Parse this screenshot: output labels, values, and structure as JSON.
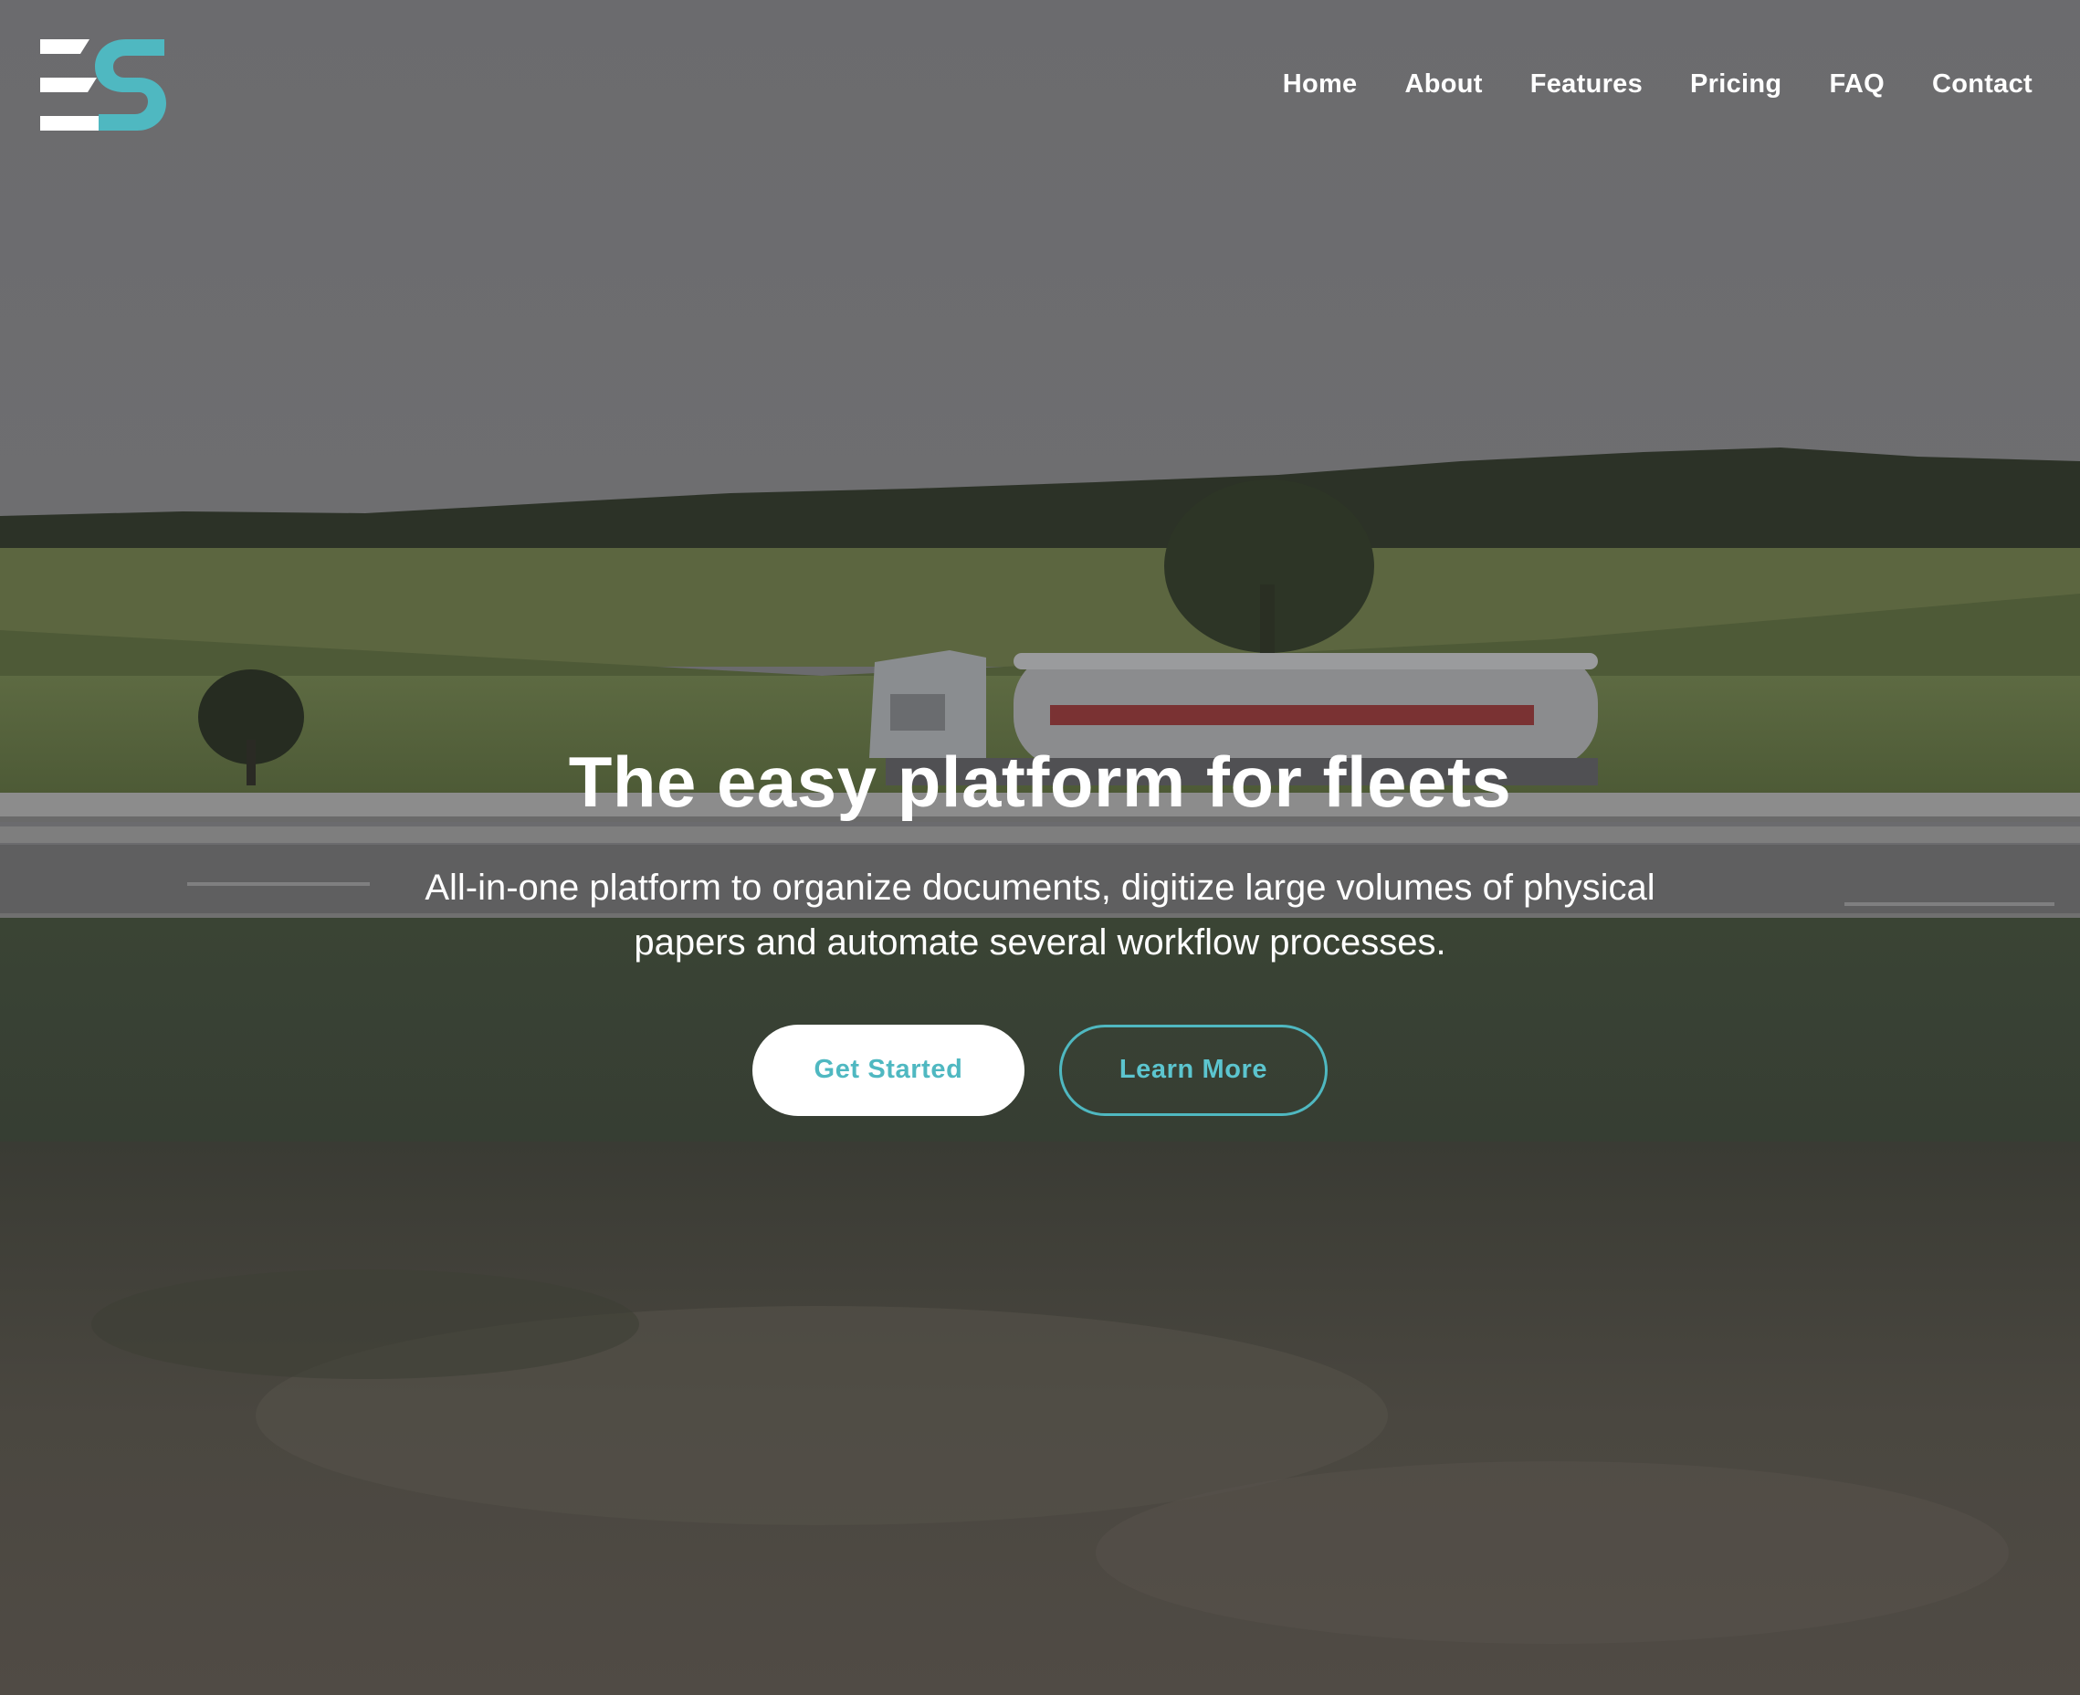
{
  "brand": {
    "logo_icon": "es-monogram-logo",
    "accent_color": "#4fb8c1"
  },
  "nav": {
    "items": [
      {
        "label": "Home"
      },
      {
        "label": "About"
      },
      {
        "label": "Features"
      },
      {
        "label": "Pricing"
      },
      {
        "label": "FAQ"
      },
      {
        "label": "Contact"
      }
    ]
  },
  "hero": {
    "title": "The easy platform for fleets",
    "subtitle": "All-in-one platform to organize documents, digitize large volumes of physical papers and automate several workflow processes.",
    "primary_cta": "Get Started",
    "secondary_cta": "Learn More"
  },
  "background": {
    "scene": "tanker-truck-on-highway-through-farmland"
  }
}
